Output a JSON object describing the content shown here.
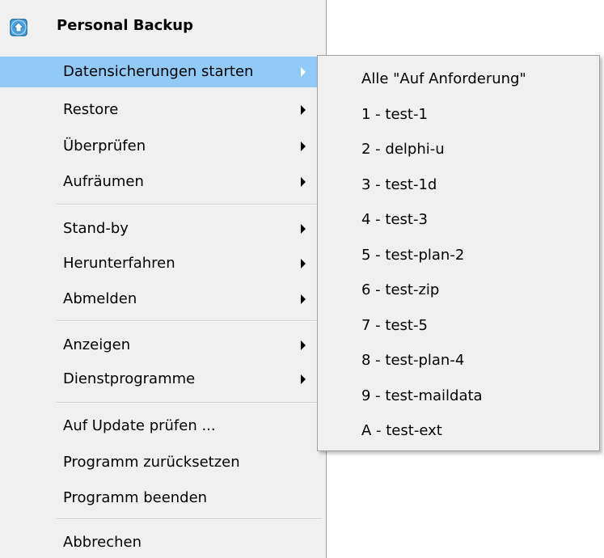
{
  "header": {
    "title": "Personal Backup",
    "icon": "backup-app-icon",
    "icon_color": "#2a8fd6"
  },
  "colors": {
    "menu_bg": "#f0f0f0",
    "highlight": "#91c9f7",
    "border": "#a0a0a0"
  },
  "menu": {
    "items": [
      {
        "label": "Datensicherungen starten",
        "submenu": true,
        "highlighted": true
      },
      {
        "label": "Restore",
        "submenu": true
      },
      {
        "label": "Überprüfen",
        "submenu": true
      },
      {
        "label": "Aufräumen",
        "submenu": true
      },
      {
        "label": "Stand-by",
        "submenu": true
      },
      {
        "label": "Herunterfahren",
        "submenu": true
      },
      {
        "label": "Abmelden",
        "submenu": true
      },
      {
        "label": "Anzeigen",
        "submenu": true
      },
      {
        "label": "Dienstprogramme",
        "submenu": true
      },
      {
        "label": "Auf Update prüfen ..."
      },
      {
        "label": "Programm zurücksetzen"
      },
      {
        "label": "Programm beenden"
      },
      {
        "label": "Abbrechen"
      }
    ]
  },
  "submenu": {
    "items": [
      {
        "label": "Alle \"Auf Anforderung\""
      },
      {
        "label": "1 - test-1"
      },
      {
        "label": "2 - delphi-u"
      },
      {
        "label": "3 - test-1d"
      },
      {
        "label": "4 - test-3"
      },
      {
        "label": "5 - test-plan-2"
      },
      {
        "label": "6 - test-zip"
      },
      {
        "label": "7 - test-5"
      },
      {
        "label": "8 - test-plan-4"
      },
      {
        "label": "9 - test-maildata"
      },
      {
        "label": "A - test-ext"
      }
    ]
  }
}
